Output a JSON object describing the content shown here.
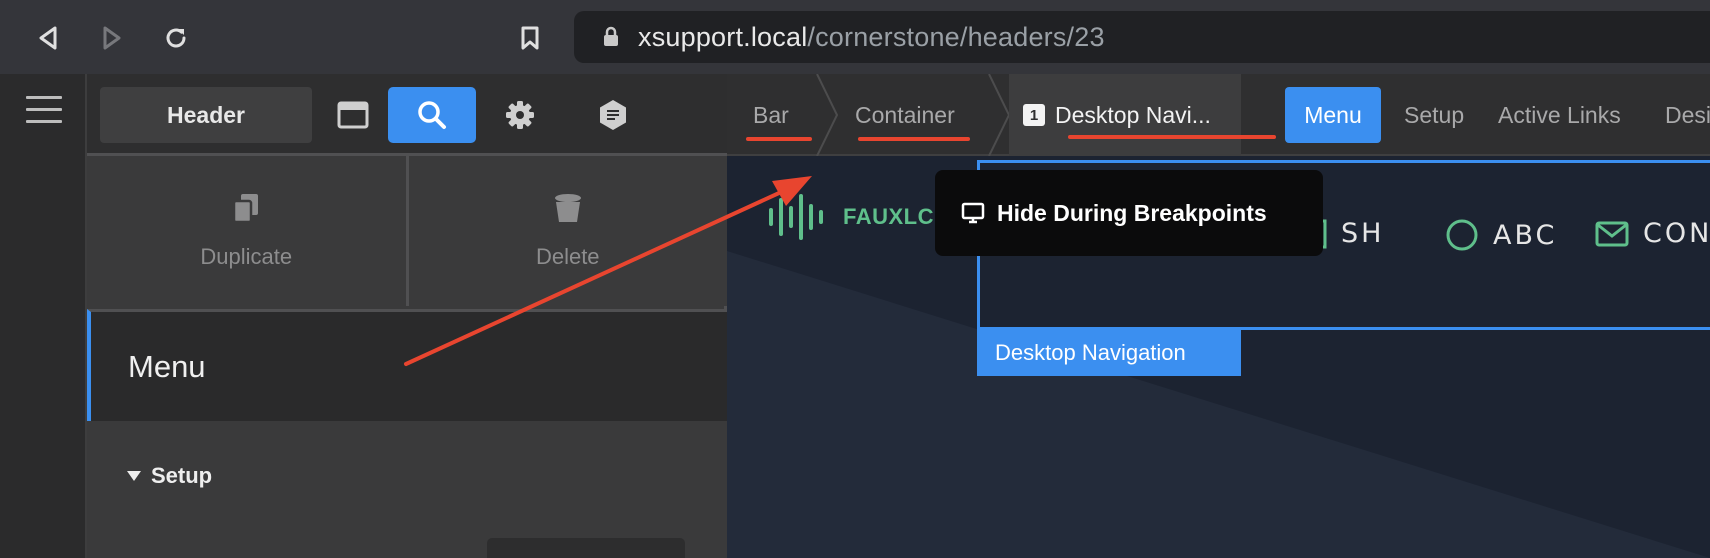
{
  "browser": {
    "url_host": "xsupport.local",
    "url_path": "/cornerstone/headers/23"
  },
  "panel": {
    "header_tab": "Header",
    "actions": {
      "duplicate": "Duplicate",
      "delete": "Delete"
    },
    "selected_item": "Menu",
    "section": "Setup"
  },
  "breadcrumbs": [
    {
      "label": "Bar"
    },
    {
      "label": "Container"
    },
    {
      "label": "Desktop Navi...",
      "badge": "1"
    }
  ],
  "tabs": [
    {
      "label": "Menu",
      "active": true
    },
    {
      "label": "Setup"
    },
    {
      "label": "Active Links"
    },
    {
      "label": "Desi"
    }
  ],
  "canvas": {
    "logo_text": "FAUXLC",
    "nav_items": [
      {
        "label": "SH",
        "icon": "square-icon"
      },
      {
        "label": "ABC",
        "icon": "circle-icon"
      },
      {
        "label": "CON",
        "icon": "envelope-icon"
      }
    ],
    "selection_label": "Desktop Navigation",
    "tooltip": "Hide During Breakpoints"
  },
  "colors": {
    "accent": "#3b8ff0",
    "annotation": "#e8452f",
    "logo": "#5fbf8b"
  }
}
